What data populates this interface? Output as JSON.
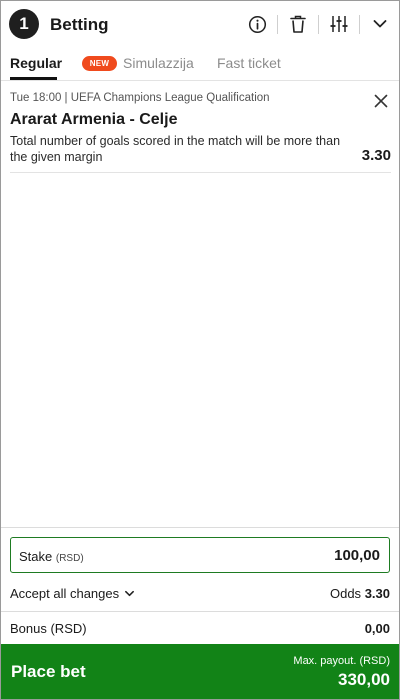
{
  "header": {
    "count": "1",
    "title": "Betting",
    "icons": [
      "info-icon",
      "trash-icon",
      "sliders-icon",
      "chevron-down-icon"
    ]
  },
  "tabs": [
    {
      "label": "Regular",
      "active": true
    },
    {
      "label": "Simulazzija",
      "badge": "NEW"
    },
    {
      "label": "Fast ticket"
    }
  ],
  "bet": {
    "meta": "Tue 18:00 | UEFA Champions League Qualification",
    "match": "Ararat Armenia - Celje",
    "description": "Total number of goals scored in the match will be more than the given margin",
    "odds": "3.30"
  },
  "stake": {
    "label": "Stake",
    "currency": "(RSD)",
    "value": "100,00"
  },
  "accept": {
    "label": "Accept all changes"
  },
  "odds_summary": {
    "label": "Odds",
    "value": "3.30"
  },
  "bonus": {
    "label": "Bonus (RSD)",
    "value": "0,00"
  },
  "place_bet": {
    "label": "Place bet",
    "payout_label": "Max. payout. (RSD)",
    "payout_value": "330,00"
  },
  "colors": {
    "accent_green": "#128317",
    "stake_border": "#1e7b22",
    "new_badge": "#f04a1d"
  }
}
